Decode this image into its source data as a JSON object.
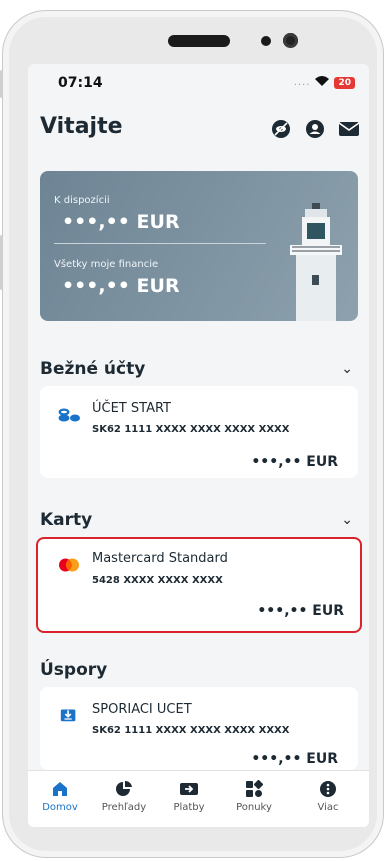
{
  "status": {
    "time": "07:14",
    "signal_dots": "....",
    "battery": "20"
  },
  "header": {
    "title": "Vitajte"
  },
  "balance_banner": {
    "available_label": "K dispozícii",
    "available_amount": "•••,•• EUR",
    "all_finances_label": "Všetky moje financie",
    "all_finances_amount": "•••,•• EUR"
  },
  "sections": {
    "current_accounts": {
      "title": "Bežné účty",
      "account": {
        "name": "ÚČET START",
        "number": "SK62 1111 XXXX XXXX XXXX XXXX",
        "balance": "•••,•• EUR"
      }
    },
    "cards": {
      "title": "Karty",
      "card": {
        "name": "Mastercard Standard",
        "number": "5428 XXXX XXXX XXXX",
        "balance": "•••,•• EUR"
      }
    },
    "savings": {
      "title": "Úspory",
      "account": {
        "name": "SPORIACI UCET",
        "number": "SK62 1111 XXXX XXXX XXXX XXXX",
        "balance": "•••,•• EUR"
      }
    }
  },
  "nav": {
    "items": [
      {
        "label": "Domov",
        "icon": "home-icon"
      },
      {
        "label": "Prehľady",
        "icon": "pie-chart-icon"
      },
      {
        "label": "Platby",
        "icon": "payment-icon"
      },
      {
        "label": "Ponuky",
        "icon": "offers-icon"
      },
      {
        "label": "Viac",
        "icon": "more-icon"
      }
    ]
  },
  "colors": {
    "accent": "#1a73c8",
    "highlight": "#d8232a",
    "text": "#1d2a33"
  }
}
